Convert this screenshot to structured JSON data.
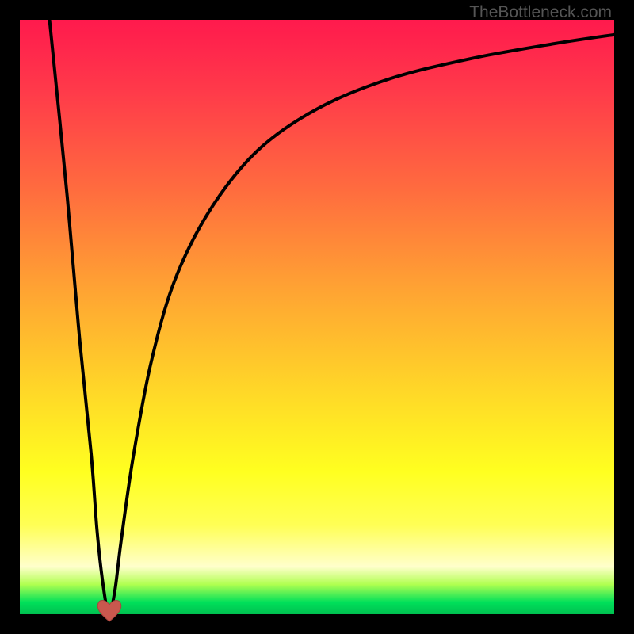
{
  "watermark": {
    "text": "TheBottleneck.com"
  },
  "colors": {
    "curve": "#000000",
    "heart": "#c9584e",
    "frame": "#000000"
  },
  "chart_data": {
    "type": "line",
    "title": "",
    "xlabel": "",
    "ylabel": "",
    "xlim": [
      0,
      100
    ],
    "ylim": [
      0,
      100
    ],
    "annotations": [
      "heart marker at curve minimum (x≈15, y≈0)"
    ],
    "series": [
      {
        "name": "bottleneck-curve",
        "x": [
          5,
          8,
          10,
          12,
          13,
          14,
          15,
          16,
          17,
          19,
          22,
          26,
          32,
          40,
          50,
          62,
          76,
          90,
          100
        ],
        "y": [
          100,
          70,
          47,
          27,
          14,
          5,
          0,
          4,
          12,
          26,
          42,
          56,
          68,
          78,
          85,
          90,
          93.5,
          96,
          97.5
        ]
      }
    ],
    "background_gradient": {
      "stops": [
        {
          "pos": 0.0,
          "color": "#ff1a4d"
        },
        {
          "pos": 0.12,
          "color": "#ff3a4a"
        },
        {
          "pos": 0.28,
          "color": "#ff6a3f"
        },
        {
          "pos": 0.45,
          "color": "#ffa233"
        },
        {
          "pos": 0.62,
          "color": "#ffd628"
        },
        {
          "pos": 0.76,
          "color": "#ffff20"
        },
        {
          "pos": 0.85,
          "color": "#ffff55"
        },
        {
          "pos": 0.92,
          "color": "#ffffcc"
        },
        {
          "pos": 0.95,
          "color": "#b0ff50"
        },
        {
          "pos": 0.98,
          "color": "#00e05a"
        },
        {
          "pos": 1.0,
          "color": "#00c050"
        }
      ]
    }
  }
}
